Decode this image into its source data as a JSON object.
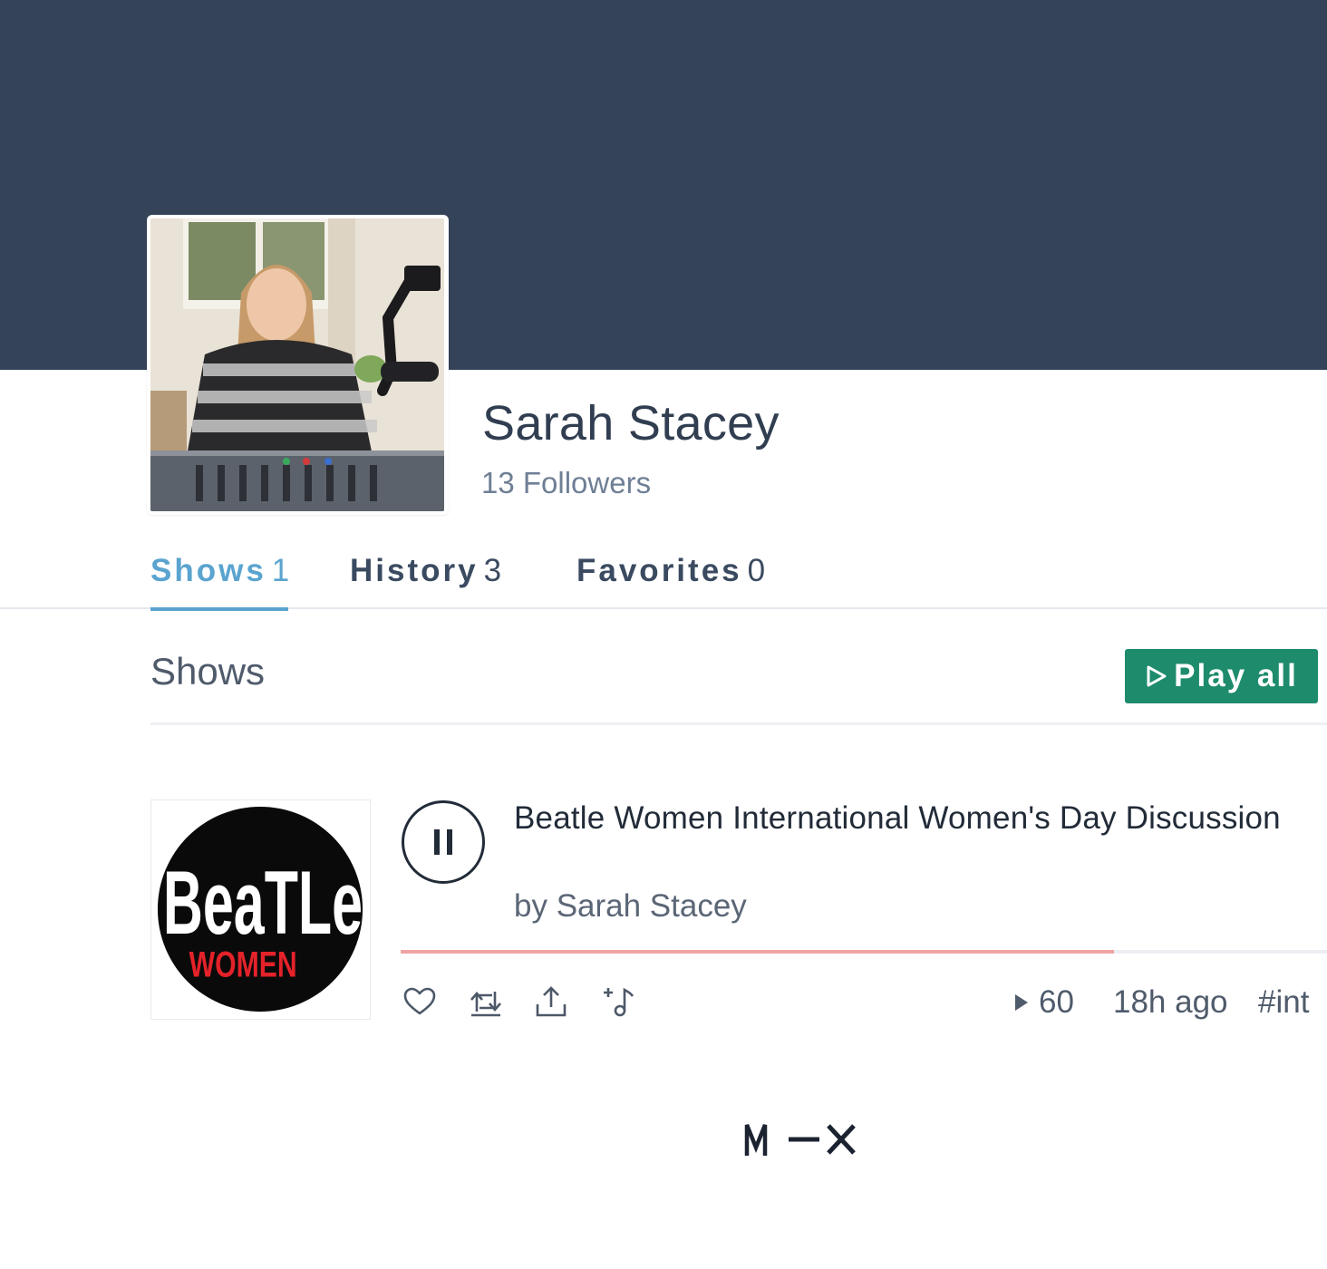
{
  "profile": {
    "name": "Sarah Stacey",
    "followers": "13 Followers"
  },
  "tabs": [
    {
      "label": "Shows",
      "count": "1",
      "active": true
    },
    {
      "label": "History",
      "count": "3",
      "active": false
    },
    {
      "label": "Favorites",
      "count": "0",
      "active": false
    }
  ],
  "section": {
    "title": "Shows",
    "play_all_label": "Play all"
  },
  "show": {
    "title": "Beatle Women International Women's Day Discussion",
    "author": "by Sarah Stacey",
    "art_text_top": "BeaTLe",
    "art_text_bottom": "WOMEN",
    "plays": "60",
    "time_ago": "18h ago",
    "tag": "#int",
    "progress": 0.77
  },
  "icons": {
    "favorite": "heart-icon",
    "repost": "repost-icon",
    "share": "share-icon",
    "add_to_queue": "add-to-queue-icon",
    "pause": "pause-icon",
    "play": "play-icon"
  },
  "colors": {
    "banner": "#344358",
    "accent": "#5aa4cf",
    "play_all": "#1e8b6d",
    "progress": "#f0a3a3"
  },
  "footer": {
    "logo": "M–X"
  }
}
